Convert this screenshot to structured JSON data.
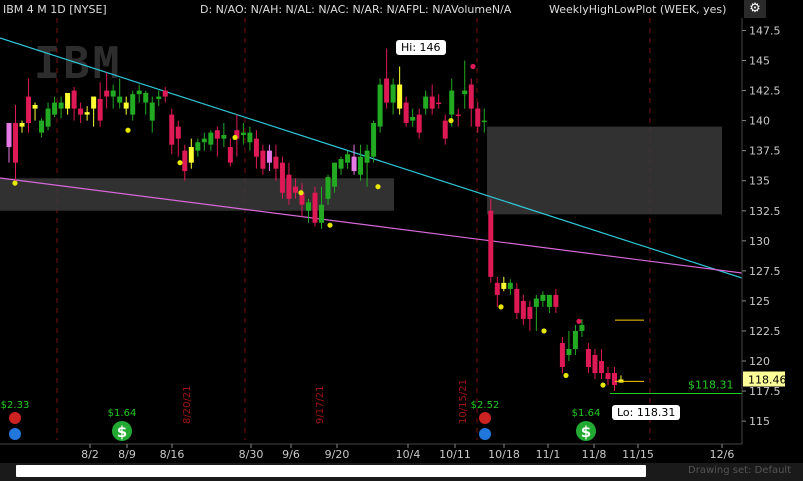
{
  "header": {
    "symbol": "IBM 4 M 1D [NYSE]",
    "study_values": "D: N/AO: N/AH: N/AL: N/AC: N/AR: N/AFPL: N/AVolumeN/A",
    "study_name": "WeeklyHighLowPlot (WEEK, yes)"
  },
  "logo_text": "IBM",
  "callouts": {
    "high": "Hi: 146",
    "low": "Lo: 118.31"
  },
  "price_label": {
    "value": "118.46",
    "color": "#ffff99"
  },
  "alert_label": {
    "value": "$118.31",
    "color": "#22cc22"
  },
  "event_marks": [
    {
      "date_label": "8/20/21"
    },
    {
      "date_label": "9/17/21"
    },
    {
      "date_label": "10/15/21"
    }
  ],
  "dividends": [
    {
      "amount": "$1.64"
    },
    {
      "amount": "$1.64"
    }
  ],
  "earnings": [
    {
      "amount": "$2.33"
    },
    {
      "amount": "$2.52"
    }
  ],
  "colors": {
    "up": "#22aa22",
    "down": "#dd1a55",
    "doji": "#ffff33",
    "pink": "#e87ae8",
    "trendline_cyan": "#2ec6d6",
    "trendline_magenta": "#d768d7",
    "zone": "#3a3a3a",
    "low_dot": "#e6e600"
  },
  "chart_data": {
    "type": "candlestick",
    "title": "IBM 4 M 1D [NYSE]",
    "x_ticks": [
      "8/2",
      "8/9",
      "8/16",
      "8/30",
      "9/6",
      "9/20",
      "10/4",
      "10/11",
      "10/18",
      "11/1",
      "11/8",
      "11/15",
      "12/6"
    ],
    "y_ticks": [
      115,
      117.5,
      120,
      122.5,
      125,
      127.5,
      130,
      132.5,
      135,
      137.5,
      140,
      142.5,
      145,
      147.5
    ],
    "ylim": [
      113.3,
      149.2
    ],
    "grid": false,
    "high": 146,
    "low": 118.31,
    "last": 118.46,
    "candles": [
      {
        "o": 137.8,
        "h": 138.5,
        "c": 139.8,
        "l": 136.5,
        "k": "pink"
      },
      {
        "o": 139.8,
        "h": 141.3,
        "c": 136.5,
        "l": 135.0,
        "k": "down"
      },
      {
        "o": 139.5,
        "h": 140.0,
        "c": 139.8,
        "l": 139.0,
        "k": "doji"
      },
      {
        "o": 139.8,
        "h": 143.5,
        "c": 142.0,
        "l": 139.0,
        "k": "down"
      },
      {
        "o": 141.3,
        "h": 141.5,
        "c": 141.0,
        "l": 140.0,
        "k": "doji"
      },
      {
        "o": 139.0,
        "h": 140.2,
        "c": 140.0,
        "l": 138.6,
        "k": "up"
      },
      {
        "o": 139.5,
        "h": 141.5,
        "c": 141.0,
        "l": 139.2,
        "k": "up"
      },
      {
        "o": 140.5,
        "h": 142.0,
        "c": 141.5,
        "l": 140.3,
        "k": "up"
      },
      {
        "o": 141.5,
        "h": 142.0,
        "c": 141.0,
        "l": 140.2,
        "k": "up"
      },
      {
        "o": 141.0,
        "h": 142.0,
        "c": 142.3,
        "l": 140.5,
        "k": "doji"
      },
      {
        "o": 142.5,
        "h": 142.8,
        "c": 141.0,
        "l": 140.0,
        "k": "down"
      },
      {
        "o": 141.0,
        "h": 141.5,
        "c": 140.5,
        "l": 139.8,
        "k": "down"
      },
      {
        "o": 140.7,
        "h": 141.2,
        "c": 140.5,
        "l": 140.0,
        "k": "doji"
      },
      {
        "o": 141.0,
        "h": 141.5,
        "c": 142.0,
        "l": 139.5,
        "k": "doji"
      },
      {
        "o": 140.0,
        "h": 143.2,
        "c": 141.8,
        "l": 139.5,
        "k": "down"
      },
      {
        "o": 142.0,
        "h": 144.0,
        "c": 142.5,
        "l": 141.0,
        "k": "down"
      },
      {
        "o": 142.5,
        "h": 143.0,
        "c": 142.0,
        "l": 141.0,
        "k": "up"
      },
      {
        "o": 142.0,
        "h": 143.5,
        "c": 141.5,
        "l": 141.0,
        "k": "up"
      },
      {
        "o": 141.0,
        "h": 142.0,
        "c": 141.5,
        "l": 140.5,
        "k": "doji"
      },
      {
        "o": 140.5,
        "h": 142.5,
        "c": 142.2,
        "l": 140.0,
        "k": "up"
      },
      {
        "o": 142.2,
        "h": 143.0,
        "c": 142.5,
        "l": 141.5,
        "k": "up"
      },
      {
        "o": 141.5,
        "h": 142.5,
        "c": 142.3,
        "l": 140.5,
        "k": "up"
      },
      {
        "o": 140.0,
        "h": 142.0,
        "c": 141.5,
        "l": 139.0,
        "k": "up"
      },
      {
        "o": 142.0,
        "h": 142.5,
        "c": 141.8,
        "l": 141.2,
        "k": "up"
      },
      {
        "o": 142.5,
        "h": 142.8,
        "c": 142.0,
        "l": 141.5,
        "k": "down"
      },
      {
        "o": 140.5,
        "h": 141.0,
        "c": 138.0,
        "l": 137.2,
        "k": "down"
      },
      {
        "o": 139.5,
        "h": 140.0,
        "c": 138.5,
        "l": 137.0,
        "k": "down"
      },
      {
        "o": 137.5,
        "h": 138.0,
        "c": 135.8,
        "l": 135.0,
        "k": "down"
      },
      {
        "o": 136.5,
        "h": 138.5,
        "c": 137.8,
        "l": 136.0,
        "k": "doji"
      },
      {
        "o": 137.5,
        "h": 138.5,
        "c": 138.2,
        "l": 137.0,
        "k": "up"
      },
      {
        "o": 138.5,
        "h": 139.0,
        "c": 138.2,
        "l": 137.5,
        "k": "up"
      },
      {
        "o": 138.0,
        "h": 139.2,
        "c": 139.0,
        "l": 137.5,
        "k": "up"
      },
      {
        "o": 139.2,
        "h": 139.5,
        "c": 138.5,
        "l": 137.0,
        "k": "down"
      },
      {
        "o": 138.5,
        "h": 139.8,
        "c": 138.8,
        "l": 137.8,
        "k": "up"
      },
      {
        "o": 137.8,
        "h": 138.5,
        "c": 136.5,
        "l": 136.2,
        "k": "down"
      },
      {
        "o": 139.2,
        "h": 140.5,
        "c": 138.5,
        "l": 137.0,
        "k": "down"
      },
      {
        "o": 139.0,
        "h": 139.8,
        "c": 138.8,
        "l": 138.0,
        "k": "up"
      },
      {
        "o": 138.2,
        "h": 139.5,
        "c": 139.0,
        "l": 137.5,
        "k": "up"
      },
      {
        "o": 138.5,
        "h": 139.2,
        "c": 137.0,
        "l": 136.0,
        "k": "down"
      },
      {
        "o": 137.5,
        "h": 138.0,
        "c": 136.0,
        "l": 135.5,
        "k": "down"
      },
      {
        "o": 137.5,
        "h": 138.0,
        "c": 136.5,
        "l": 135.8,
        "k": "pink"
      },
      {
        "o": 137.0,
        "h": 138.0,
        "c": 136.0,
        "l": 135.0,
        "k": "down"
      },
      {
        "o": 136.5,
        "h": 137.0,
        "c": 134.0,
        "l": 133.5,
        "k": "down"
      },
      {
        "o": 135.5,
        "h": 136.5,
        "c": 133.5,
        "l": 133.0,
        "k": "down"
      },
      {
        "o": 134.5,
        "h": 135.2,
        "c": 134.0,
        "l": 133.5,
        "k": "down"
      },
      {
        "o": 134.0,
        "h": 134.8,
        "c": 133.0,
        "l": 132.0,
        "k": "down"
      },
      {
        "o": 132.5,
        "h": 133.5,
        "c": 133.2,
        "l": 131.5,
        "k": "up"
      },
      {
        "o": 134.0,
        "h": 134.5,
        "c": 131.5,
        "l": 131.2,
        "k": "down"
      },
      {
        "o": 131.5,
        "h": 134.5,
        "c": 133.0,
        "l": 131.0,
        "k": "up"
      },
      {
        "o": 133.5,
        "h": 135.5,
        "c": 135.3,
        "l": 133.0,
        "k": "up"
      },
      {
        "o": 134.5,
        "h": 136.5,
        "c": 136.5,
        "l": 134.0,
        "k": "up"
      },
      {
        "o": 136.0,
        "h": 137.0,
        "c": 136.8,
        "l": 135.5,
        "k": "up"
      },
      {
        "o": 136.5,
        "h": 137.5,
        "c": 137.2,
        "l": 136.0,
        "k": "up"
      },
      {
        "o": 137.0,
        "h": 138.0,
        "c": 135.8,
        "l": 135.5,
        "k": "pink"
      },
      {
        "o": 135.5,
        "h": 138.0,
        "c": 137.0,
        "l": 135.0,
        "k": "up"
      },
      {
        "o": 136.5,
        "h": 138.0,
        "c": 137.5,
        "l": 134.5,
        "k": "up"
      },
      {
        "o": 137.0,
        "h": 140.0,
        "c": 139.8,
        "l": 136.5,
        "k": "up"
      },
      {
        "o": 139.5,
        "h": 143.5,
        "c": 143.0,
        "l": 139.0,
        "k": "up"
      },
      {
        "o": 143.5,
        "h": 146.0,
        "c": 141.5,
        "l": 141.0,
        "k": "down"
      },
      {
        "o": 141.5,
        "h": 143.5,
        "c": 143.0,
        "l": 140.5,
        "k": "up"
      },
      {
        "o": 143.0,
        "h": 144.5,
        "c": 141.0,
        "l": 140.5,
        "k": "doji"
      },
      {
        "o": 141.5,
        "h": 142.0,
        "c": 139.8,
        "l": 139.5,
        "k": "down"
      },
      {
        "o": 140.0,
        "h": 141.0,
        "c": 140.3,
        "l": 139.5,
        "k": "up"
      },
      {
        "o": 140.5,
        "h": 141.0,
        "c": 139.0,
        "l": 138.5,
        "k": "down"
      },
      {
        "o": 141.0,
        "h": 142.5,
        "c": 142.0,
        "l": 140.5,
        "k": "up"
      },
      {
        "o": 142.0,
        "h": 143.0,
        "c": 141.0,
        "l": 140.5,
        "k": "down"
      },
      {
        "o": 141.5,
        "h": 142.2,
        "c": 141.5,
        "l": 141.0,
        "k": "down"
      },
      {
        "o": 140.0,
        "h": 140.5,
        "c": 138.5,
        "l": 138.0,
        "k": "down"
      },
      {
        "o": 140.5,
        "h": 143.5,
        "c": 142.5,
        "l": 139.5,
        "k": "up"
      },
      {
        "o": 140.5,
        "h": 141.0,
        "c": 140.5,
        "l": 139.5,
        "k": "down"
      },
      {
        "o": 142.5,
        "h": 145.0,
        "c": 142.2,
        "l": 141.0,
        "k": "up"
      },
      {
        "o": 143.0,
        "h": 143.5,
        "c": 141.0,
        "l": 139.5,
        "k": "down"
      },
      {
        "o": 141.0,
        "h": 141.5,
        "c": 139.5,
        "l": 139.0,
        "k": "down"
      },
      {
        "o": 140.0,
        "h": 141.0,
        "c": 140.0,
        "l": 139.0,
        "k": "up"
      },
      {
        "o": 132.5,
        "h": 133.5,
        "c": 127.0,
        "l": 126.5,
        "k": "down"
      },
      {
        "o": 126.5,
        "h": 127.0,
        "c": 125.5,
        "l": 124.5,
        "k": "down"
      },
      {
        "o": 126.0,
        "h": 127.0,
        "c": 126.5,
        "l": 125.8,
        "k": "doji"
      },
      {
        "o": 126.5,
        "h": 126.8,
        "c": 126.0,
        "l": 125.5,
        "k": "up"
      },
      {
        "o": 126.0,
        "h": 126.5,
        "c": 124.0,
        "l": 123.5,
        "k": "down"
      },
      {
        "o": 125.0,
        "h": 125.5,
        "c": 123.5,
        "l": 123.0,
        "k": "down"
      },
      {
        "o": 124.5,
        "h": 125.0,
        "c": 123.5,
        "l": 122.5,
        "k": "down"
      },
      {
        "o": 124.5,
        "h": 125.5,
        "c": 125.2,
        "l": 122.5,
        "k": "up"
      },
      {
        "o": 125.5,
        "h": 125.8,
        "c": 125.0,
        "l": 124.5,
        "k": "up"
      },
      {
        "o": 124.5,
        "h": 125.5,
        "c": 125.5,
        "l": 124.0,
        "k": "up"
      },
      {
        "o": 125.5,
        "h": 126.0,
        "c": 124.5,
        "l": 124.0,
        "k": "down"
      },
      {
        "o": 121.5,
        "h": 122.0,
        "c": 119.5,
        "l": 119.0,
        "k": "down"
      },
      {
        "o": 121.0,
        "h": 122.5,
        "c": 120.5,
        "l": 120.0,
        "k": "up"
      },
      {
        "o": 121.0,
        "h": 123.0,
        "c": 122.5,
        "l": 120.5,
        "k": "up"
      },
      {
        "o": 122.5,
        "h": 123.5,
        "c": 123.0,
        "l": 122.0,
        "k": "up"
      },
      {
        "o": 121.0,
        "h": 121.5,
        "c": 119.5,
        "l": 119.0,
        "k": "down"
      },
      {
        "o": 120.5,
        "h": 121.0,
        "c": 119.0,
        "l": 118.5,
        "k": "down"
      },
      {
        "o": 120.0,
        "h": 121.0,
        "c": 119.0,
        "l": 118.5,
        "k": "down"
      },
      {
        "o": 119.0,
        "h": 119.5,
        "c": 118.5,
        "l": 118.0,
        "k": "down"
      },
      {
        "o": 119.0,
        "h": 119.5,
        "c": 118.0,
        "l": 117.5,
        "k": "down"
      },
      {
        "o": 118.2,
        "h": 118.8,
        "c": 118.46,
        "l": 118.31,
        "k": "doji"
      }
    ]
  }
}
